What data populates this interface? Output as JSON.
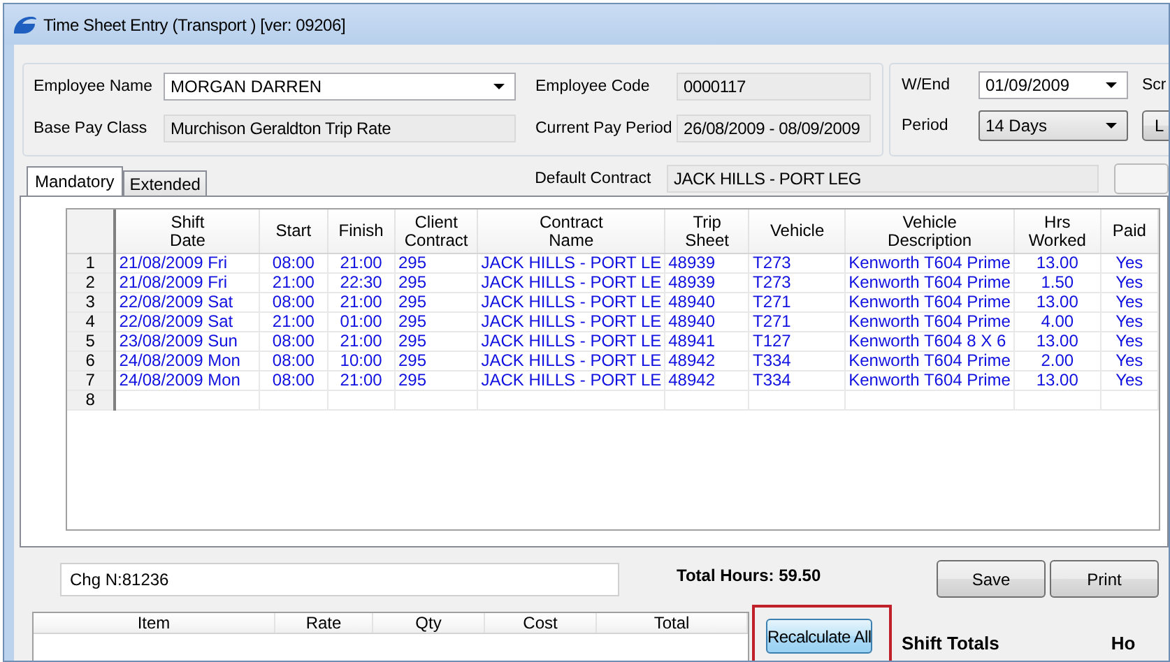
{
  "window": {
    "title": "Time Sheet Entry (Transport ) [ver: 09206]"
  },
  "employee": {
    "name_label": "Employee Name",
    "name": "MORGAN DARREN",
    "code_label": "Employee Code",
    "code": "0000117",
    "base_pay_class_label": "Base Pay Class",
    "base_pay_class": "Murchison Geraldton Trip Rate",
    "pay_period_label": "Current Pay Period",
    "pay_period": "26/08/2009 - 08/09/2009",
    "default_contract_label": "Default Contract",
    "default_contract": "JACK HILLS - PORT LEG"
  },
  "period": {
    "wend_label": "W/End",
    "wend": "01/09/2009",
    "period_label": "Period",
    "period": "14 Days",
    "column_3_label": "Scr",
    "column_3_button": "L"
  },
  "tabs": [
    {
      "label": "Mandatory",
      "selected": true
    },
    {
      "label": "Extended",
      "selected": false
    }
  ],
  "shifts": {
    "columns": [
      "Shift\nDate",
      "Start",
      "Finish",
      "Client\nContract",
      "Contract\nName",
      "Trip\nSheet",
      "Vehicle",
      "Vehicle\nDescription",
      "Hrs\nWorked",
      "Paid"
    ],
    "rows": [
      {
        "number": "1",
        "cells": [
          "21/08/2009 Fri",
          "08:00",
          "21:00",
          "295",
          "JACK HILLS - PORT LE",
          "48939",
          "T273",
          "Kenworth T604 Prime",
          "13.00",
          "Yes"
        ]
      },
      {
        "number": "2",
        "cells": [
          "21/08/2009 Fri",
          "21:00",
          "22:30",
          "295",
          "JACK HILLS - PORT LE",
          "48939",
          "T273",
          "Kenworth T604 Prime",
          "1.50",
          "Yes"
        ]
      },
      {
        "number": "3",
        "cells": [
          "22/08/2009 Sat",
          "08:00",
          "21:00",
          "295",
          "JACK HILLS - PORT LE",
          "48940",
          "T271",
          "Kenworth T604 Prime",
          "13.00",
          "Yes"
        ]
      },
      {
        "number": "4",
        "cells": [
          "22/08/2009 Sat",
          "21:00",
          "01:00",
          "295",
          "JACK HILLS - PORT LE",
          "48940",
          "T271",
          "Kenworth T604 Prime",
          "4.00",
          "Yes"
        ]
      },
      {
        "number": "5",
        "cells": [
          "23/08/2009 Sun",
          "08:00",
          "21:00",
          "295",
          "JACK HILLS - PORT LE",
          "48941",
          "T127",
          "Kenworth T604 8 X 6",
          "13.00",
          "Yes"
        ]
      },
      {
        "number": "6",
        "cells": [
          "24/08/2009 Mon",
          "08:00",
          "10:00",
          "295",
          "JACK HILLS - PORT LE",
          "48942",
          "T334",
          "Kenworth T604 Prime",
          "2.00",
          "Yes"
        ]
      },
      {
        "number": "7",
        "cells": [
          "24/08/2009 Mon",
          "08:00",
          "21:00",
          "295",
          "JACK HILLS - PORT LE",
          "48942",
          "T334",
          "Kenworth T604 Prime",
          "13.00",
          "Yes"
        ]
      },
      {
        "number": "8"
      }
    ]
  },
  "notes": {
    "value": "Chg N:81236"
  },
  "total_hours": "Total Hours: 59.50",
  "buttons": [
    "Save",
    "Print"
  ],
  "costs": {
    "columns": [
      "Item",
      "Rate",
      "Qty",
      "Cost",
      "Total"
    ]
  },
  "recalculate": {
    "label": "Recalculate All",
    "highlighted": true
  },
  "shift_totals": {
    "title": "Shift Totals",
    "column_2": "Ho"
  }
}
